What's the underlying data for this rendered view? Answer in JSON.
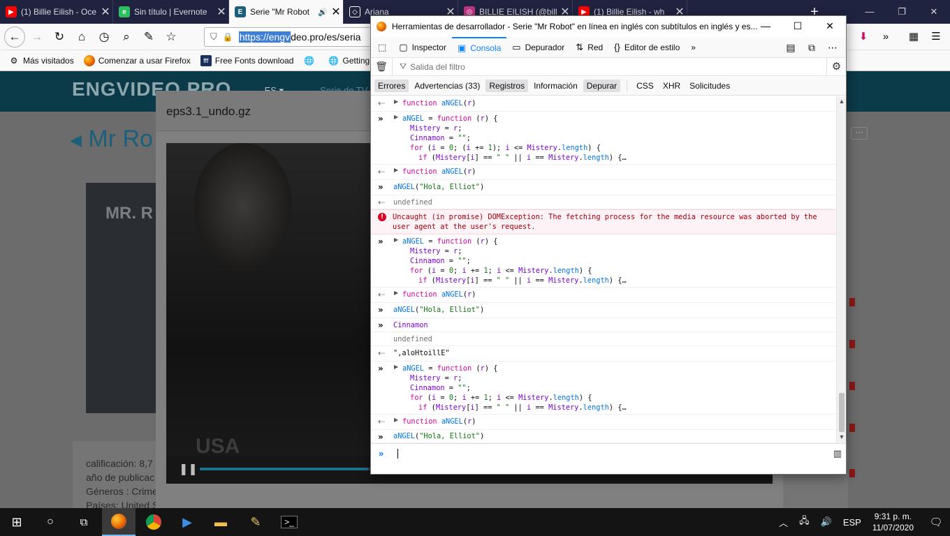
{
  "browser": {
    "tabs": [
      {
        "title": "(1) Billie Eilish - Oce",
        "icon": "youtube-icon",
        "color": "#ff0000"
      },
      {
        "title": "Sin título | Evernote",
        "icon": "evernote-icon",
        "color": "#2dbe60"
      },
      {
        "title": "Serie \"Mr Robot",
        "icon": "engvideo-icon",
        "color": "#1b5f7a",
        "audio": "🔊"
      },
      {
        "title": "Ariana",
        "icon": "codepen-icon",
        "color": "#ffffff"
      },
      {
        "title": "BILLIE EILISH (@bill",
        "icon": "instagram-icon",
        "color": "#c13584"
      },
      {
        "title": "(1) Billie Eilish - wh",
        "icon": "youtube-icon",
        "color": "#ff0000"
      }
    ],
    "url_selected": "https://engv",
    "url_rest": "deo.pro/es/seria",
    "bookmarks": [
      {
        "label": "Más visitados",
        "icon": "gear-icon"
      },
      {
        "label": "Comenzar a usar Firefox",
        "icon": "firefox-icon"
      },
      {
        "label": "Free Fonts download",
        "icon": "fonts-icon"
      },
      {
        "label": "",
        "icon": "globe-icon"
      },
      {
        "label": "Getting Sta",
        "icon": "globe-icon"
      }
    ]
  },
  "site": {
    "logo": "ENGVIDEO.PRO",
    "lang": "ES",
    "nav_item": "Serie de TV",
    "title": "Mr Ro",
    "poster_text": "MR. R",
    "info": [
      "calificación: 8,7",
      "año de publicac",
      "Géneros : Crime",
      "Países: United S"
    ]
  },
  "player": {
    "file_name": "eps3.1_undo.gz",
    "watermark": "USA",
    "progress": 0.43
  },
  "devtools": {
    "window_title": "Herramientas de desarrollador - Serie \"Mr Robot\" en línea en inglés con subtítulos en inglés y es...",
    "tabs": [
      "Inspector",
      "Consola",
      "Depurador",
      "Red",
      "Editor de estilo"
    ],
    "active_tab": "Consola",
    "filter_placeholder": "Salida del filtro",
    "chips": [
      "Errores",
      "Advertencias (33)",
      "Registros",
      "Información",
      "Depurar",
      "CSS",
      "XHR",
      "Solicitudes"
    ],
    "error_message": "Uncaught (in promise) DOMException: The fetching process for the media resource was aborted by the user agent at the user's request.",
    "values": {
      "undefined": "undefined",
      "cinnamon": "Cinnamon",
      "reversed": "\",aloHtoillE\""
    }
  },
  "taskbar": {
    "language": "ESP",
    "time": "9:31 p. m.",
    "date": "11/07/2020"
  }
}
